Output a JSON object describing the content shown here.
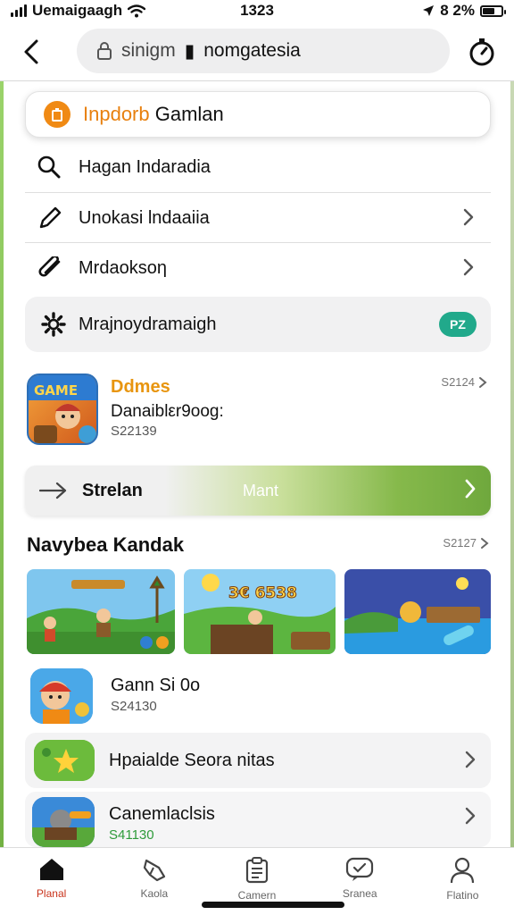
{
  "status_bar": {
    "carrier": "Uemaigaagh",
    "time": "1323",
    "battery_text": "8 2%"
  },
  "url_bar": {
    "host": "sinigm",
    "path": "nomgatesia"
  },
  "search": {
    "accent_text": "Inpdorb",
    "text": "Gamlan"
  },
  "menu": {
    "items": [
      {
        "label": "Hagan Indaradia",
        "icon": "search-icon"
      },
      {
        "label": "Unokasi lndaaiia",
        "icon": "pencil-icon"
      },
      {
        "label": "Mrdaoksoη",
        "icon": "attachment-icon"
      }
    ],
    "settings": {
      "label": "Mrajnoydramaigh",
      "badge": "PZ",
      "icon": "gear-icon"
    }
  },
  "featured_game": {
    "title": "Ddmes",
    "subtitle": "Danaiblεr9oog:",
    "price": "S22139",
    "meta": "S2124"
  },
  "banner": {
    "label": "Strelan",
    "cta": "Mant"
  },
  "section": {
    "title": "Navybea Kandak",
    "meta": "S2127"
  },
  "games": [
    {
      "title": "Gann Si 0o",
      "price": "S24130"
    }
  ],
  "cards": [
    {
      "title": "Hpaialde Seora nitas"
    }
  ],
  "game_last": {
    "title": "Canemlaclsis",
    "price": "S41130"
  },
  "tabbar": {
    "tabs": [
      {
        "label": "Planal",
        "icon": "home-icon",
        "active": true
      },
      {
        "label": "Kaola",
        "icon": "shoe-icon",
        "active": false
      },
      {
        "label": "Camern",
        "icon": "clipboard-icon",
        "active": false
      },
      {
        "label": "Sranea",
        "icon": "check-chat-icon",
        "active": false
      },
      {
        "label": "Flatino",
        "icon": "person-icon",
        "active": false
      }
    ]
  },
  "colors": {
    "accent_orange": "#f08a14",
    "badge_teal": "#21a98b",
    "active_tab": "#c9331b",
    "banner_green": "#6fa83d"
  }
}
